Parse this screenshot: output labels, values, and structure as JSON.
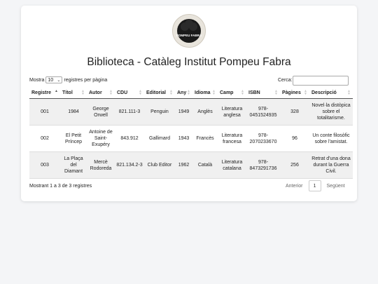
{
  "logo": {
    "text": "POMPEU FABRA"
  },
  "title": "Biblioteca - Catàleg Institut Pompeu Fabra",
  "length": {
    "prefix": "Mostra",
    "value": "10",
    "suffix": "registres per pàgina"
  },
  "search": {
    "label": "Cerca:",
    "value": ""
  },
  "table": {
    "headers": [
      "Registre",
      "Títol",
      "Autor",
      "CDU",
      "Editorial",
      "Any",
      "Idioma",
      "Camp",
      "ISBN",
      "Pàgines",
      "Descripció"
    ],
    "rows": [
      [
        "001",
        "1984",
        "George Orwell",
        "821.111-3",
        "Penguin",
        "1949",
        "Anglès",
        "Literatura anglesa",
        "978-0451524935",
        "328",
        "Novel·la distòpica sobre el totalitarisme."
      ],
      [
        "002",
        "El Petit Príncep",
        "Antoine de Saint-Exupéry",
        "843.912",
        "Gallimard",
        "1943",
        "Francès",
        "Literatura francesa",
        "978-2070233670",
        "96",
        "Un conte filosòfic sobre l'amistat."
      ],
      [
        "003",
        "La Plaça del Diamant",
        "Mercè Rodoreda",
        "821.134.2-3",
        "Club Editor",
        "1962",
        "Català",
        "Literatura catalana",
        "978-8473291736",
        "256",
        "Retrat d'una dona durant la Guerra Civil."
      ]
    ]
  },
  "info": "Mostrant 1 a 3 de 3 registres",
  "pager": {
    "previous": "Anterior",
    "current": "1",
    "next": "Següent"
  }
}
